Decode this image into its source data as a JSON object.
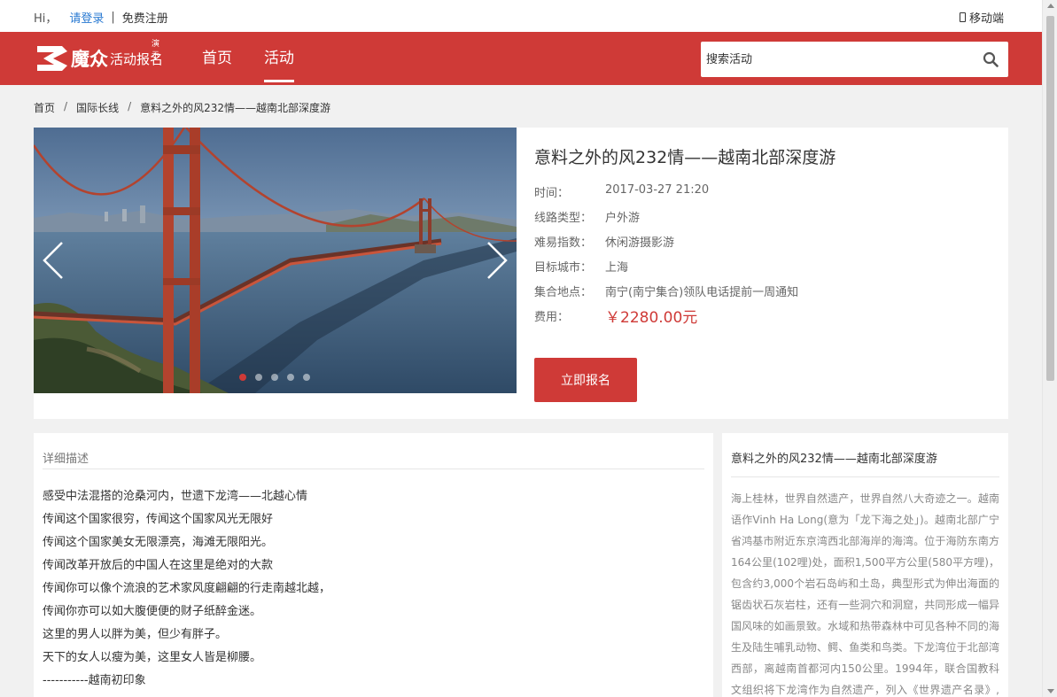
{
  "topbar": {
    "hi": "Hi，",
    "login": "请登录",
    "separator": "|",
    "register": "免费注册",
    "mobile": "移动端"
  },
  "header": {
    "brand": "魔众",
    "brand_sub": "活动报名",
    "demo_badge": "演示",
    "nav": [
      {
        "label": "首页",
        "active": false
      },
      {
        "label": "活动",
        "active": true
      }
    ],
    "search_placeholder": "搜索活动"
  },
  "breadcrumb": [
    "首页",
    "国际长线",
    "意料之外的风232情——越南北部深度游"
  ],
  "breadcrumb_sep": "/",
  "event": {
    "title": "意料之外的风232情——越南北部深度游",
    "fields": [
      {
        "label": "时间：",
        "value": "2017-03-27 21:20"
      },
      {
        "label": "线路类型：",
        "value": "户外游"
      },
      {
        "label": "难易指数：",
        "value": "休闲游摄影游"
      },
      {
        "label": "目标城市：",
        "value": "上海"
      },
      {
        "label": "集合地点：",
        "value": "南宁(南宁集合)领队电话提前一周通知"
      }
    ],
    "price_label": "费用：",
    "price": "￥2280.00元",
    "signup_label": "立即报名",
    "slide_count": 5,
    "active_slide": 0
  },
  "description": {
    "heading": "详细描述",
    "lines": [
      "感受中法混搭的沧桑河内，世遗下龙湾——北越心情",
      "传闻这个国家很穷，传闻这个国家风光无限好",
      "传闻这个国家美女无限漂亮，海滩无限阳光。",
      "传闻改革开放后的中国人在这里是绝对的大款",
      "传闻你可以像个流浪的艺术家风度翩翩的行走南越北越，",
      "传闻你亦可以如大腹便便的财子纸醉金迷。",
      "这里的男人以胖为美，但少有胖子。",
      "天下的女人以瘦为美，这里女人皆是柳腰。",
      "-----------越南初印象"
    ]
  },
  "sidebar": {
    "title": "意料之外的风232情——越南北部深度游",
    "text": "海上桂林，世界自然遗产，世界自然八大奇迹之一。越南语作Vinh Ha Long(意为「龙下海之处」)。越南北部广宁省鸿基市附近东京湾西北部海岸的海湾。位于海防东南方164公里(102哩)处，面积1,500平方公里(580平方哩)，包含约3,000个岩石岛屿和土岛，典型形式为伸出海面的锯齿状石灰岩柱，还有一些洞穴和洞窟，共同形成一幅异国风味的如画景致。水域和热带森林中可见各种不同的海生及陆生哺乳动物、鳄、鱼类和鸟类。下龙湾位于北部湾西部，离越南首都河内150公里。1994年，联合国教科文组织将下龙湾作为自然遗产，列入《世界遗产名录》,下龙湾"
  },
  "colors": {
    "brand_red": "#cf3a37",
    "link_blue": "#2a7ad2",
    "page_bg": "#f1f1f1"
  }
}
